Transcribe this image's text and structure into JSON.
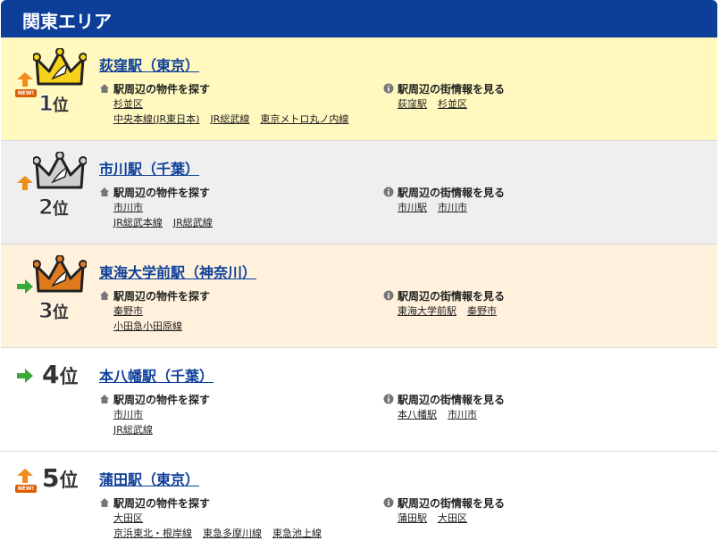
{
  "header": {
    "title": "関東エリア"
  },
  "labels": {
    "search_properties": "駅周辺の物件を探す",
    "town_info": "駅周辺の街情報を見る"
  },
  "colors": {
    "header_bg": "#0d3f99",
    "rank1_bg": "#fff8bf",
    "rank2_bg": "#efefef",
    "rank3_bg": "#fff1dc",
    "up_arrow": "#f08c1a",
    "flat_arrow": "#3aa83a"
  },
  "rankings": [
    {
      "rank_number": "1",
      "rank_suffix": "位",
      "station": "荻窪駅（東京）",
      "trend": "up",
      "new": "NEW!",
      "crown": "gold",
      "search_city": "杉並区",
      "search_lines": [
        "中央本線(JR東日本)",
        "JR総武線",
        "東京メトロ丸ノ内線"
      ],
      "info_links": [
        "荻窪駅",
        "杉並区"
      ]
    },
    {
      "rank_number": "2",
      "rank_suffix": "位",
      "station": "市川駅（千葉）",
      "trend": "up",
      "crown": "silver",
      "search_city": "市川市",
      "search_lines": [
        "JR総武本線",
        "JR総武線"
      ],
      "info_links": [
        "市川駅",
        "市川市"
      ]
    },
    {
      "rank_number": "3",
      "rank_suffix": "位",
      "station": "東海大学前駅（神奈川）",
      "trend": "flat",
      "crown": "bronze",
      "search_city": "秦野市",
      "search_lines": [
        "小田急小田原線"
      ],
      "info_links": [
        "東海大学前駅",
        "秦野市"
      ]
    },
    {
      "rank_number": "4",
      "rank_suffix": "位",
      "station": "本八幡駅（千葉）",
      "trend": "flat",
      "search_city": "市川市",
      "search_lines": [
        "JR総武線"
      ],
      "info_links": [
        "本八幡駅",
        "市川市"
      ]
    },
    {
      "rank_number": "5",
      "rank_suffix": "位",
      "station": "蒲田駅（東京）",
      "trend": "up",
      "new": "NEW!",
      "search_city": "大田区",
      "search_lines": [
        "京浜東北・根岸線",
        "東急多摩川線",
        "東急池上線"
      ],
      "info_links": [
        "蒲田駅",
        "大田区"
      ]
    }
  ]
}
